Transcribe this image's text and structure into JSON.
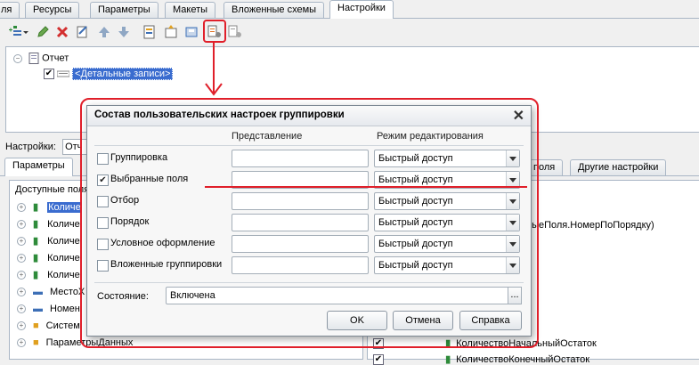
{
  "top_tabs": [
    "ля",
    "Ресурсы",
    "Параметры",
    "Макеты",
    "Вложенные схемы",
    "Настройки"
  ],
  "toolbar": {
    "icons": [
      "add-group-icon",
      "dropdown-arrow-icon",
      "edit-icon",
      "delete-icon",
      "copy-icon",
      "move-up-icon",
      "move-down-icon",
      "settings-icon-1",
      "settings-icon-2",
      "settings-icon-3",
      "user-settings-composition-icon",
      "user-settings-icon"
    ]
  },
  "tree": {
    "root_label": "Отчет",
    "child_label": "<Детальные записи>"
  },
  "settings": {
    "label": "Настройки:",
    "value": "Отч"
  },
  "bottom_tabs": {
    "left": "Параметры",
    "right_partial": "поля",
    "right": "Другие настройки"
  },
  "left_panel": {
    "header": "Доступные поля",
    "rows": [
      "Количе",
      "Количе",
      "Количе",
      "Количе",
      "Количе",
      "МестоХ",
      "Номен",
      "Систем",
      "ПараметрыДанных"
    ]
  },
  "right_panel": {
    "line1": "ныеПоля.НомерПоПорядку)",
    "line2": "КоличествоНачальныйОстаток",
    "line3": "КоличествоКонечныйОстаток"
  },
  "dialog": {
    "title": "Состав пользовательских настроек группировки",
    "col_representation": "Представление",
    "col_mode": "Режим редактирования",
    "rows": [
      {
        "label": "Группировка",
        "checked": false,
        "mode": "Быстрый доступ"
      },
      {
        "label": "Выбранные поля",
        "checked": true,
        "mode": "Быстрый доступ"
      },
      {
        "label": "Отбор",
        "checked": false,
        "mode": "Быстрый доступ"
      },
      {
        "label": "Порядок",
        "checked": false,
        "mode": "Быстрый доступ"
      },
      {
        "label": "Условное оформление",
        "checked": false,
        "mode": "Быстрый доступ"
      },
      {
        "label": "Вложенные группировки",
        "checked": false,
        "mode": "Быстрый доступ"
      }
    ],
    "state_label": "Состояние:",
    "state_value": "Включена",
    "state_btn": "...",
    "ok": "OK",
    "cancel": "Отмена",
    "help": "Справка"
  },
  "colors": {
    "annotation_red": "#e01f2a",
    "selection_blue": "#3a6ccf"
  }
}
